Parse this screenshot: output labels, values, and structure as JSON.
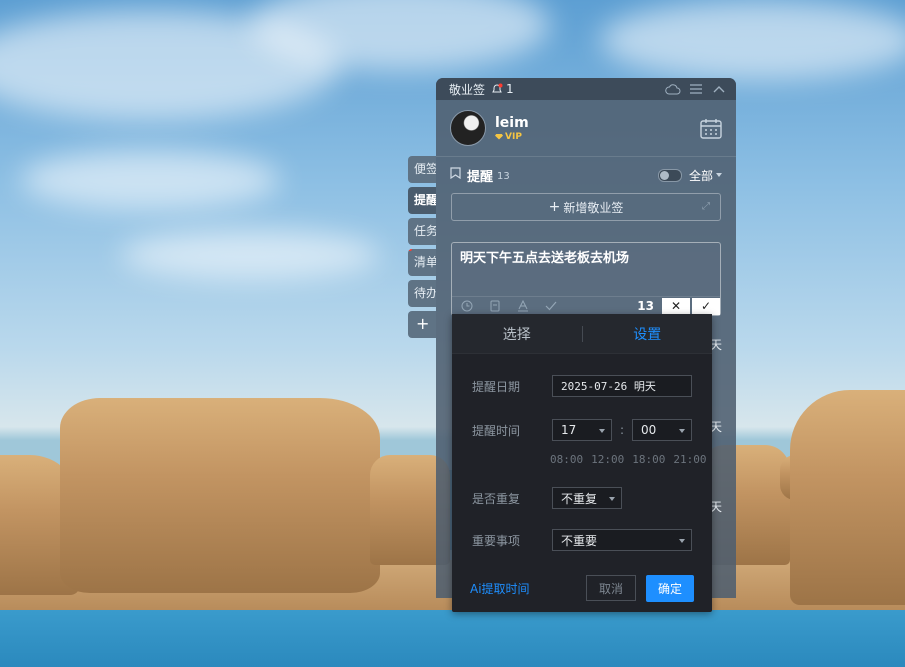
{
  "app": {
    "title": "敬业签",
    "notification_count": "1"
  },
  "user": {
    "name": "leim",
    "badge": "VIP"
  },
  "side_tabs": [
    {
      "label": "便签"
    },
    {
      "label": "提醒"
    },
    {
      "label": "任务"
    },
    {
      "label": "清单"
    },
    {
      "label": "待办"
    }
  ],
  "side_add_label": "+",
  "section": {
    "title": "提醒",
    "count": "13",
    "filter_label": "全部"
  },
  "add_button_label": "新增敬业签",
  "editor": {
    "text": "明天下午五点去送老板去机场",
    "char_count": "13",
    "cancel_glyph": "✕",
    "confirm_glyph": "✓"
  },
  "background_items": [
    {
      "label": "天"
    },
    {
      "label": "天"
    },
    {
      "label": "天"
    }
  ],
  "popup": {
    "tabs": [
      "选择",
      "设置"
    ],
    "active_tab": "设置",
    "date_label": "提醒日期",
    "date_value": "2025-07-26 明天",
    "time_label": "提醒时间",
    "hour_value": "17",
    "time_sep": ":",
    "minute_value": "00",
    "quick_times": [
      "08:00",
      "12:00",
      "18:00",
      "21:00"
    ],
    "repeat_label": "是否重复",
    "repeat_value": "不重复",
    "importance_label": "重要事项",
    "importance_value": "不重要",
    "ai_link": "Ai提取时间",
    "cancel_label": "取消",
    "confirm_label": "确定"
  },
  "colors": {
    "accent": "#1e8fff",
    "panel": "#4e5f70",
    "popup_bg": "#202228",
    "vip": "#f5c542"
  }
}
